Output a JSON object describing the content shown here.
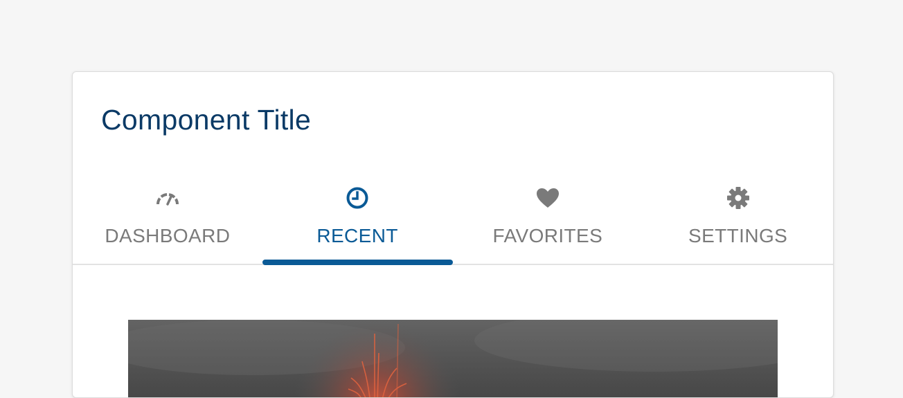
{
  "component": {
    "title": "Component Title"
  },
  "tabs": [
    {
      "label": "DASHBOARD",
      "icon": "gauge-icon",
      "active": false
    },
    {
      "label": "RECENT",
      "icon": "clock-icon",
      "active": true
    },
    {
      "label": "FAVORITES",
      "icon": "heart-icon",
      "active": false
    },
    {
      "label": "SETTINGS",
      "icon": "gear-icon",
      "active": false
    }
  ],
  "colors": {
    "accent": "#0a5a96",
    "title": "#0b3a66",
    "inactive": "#7a7a7a",
    "background": "#f6f6f6"
  },
  "content": {
    "image": "volcano-eruption-image"
  }
}
